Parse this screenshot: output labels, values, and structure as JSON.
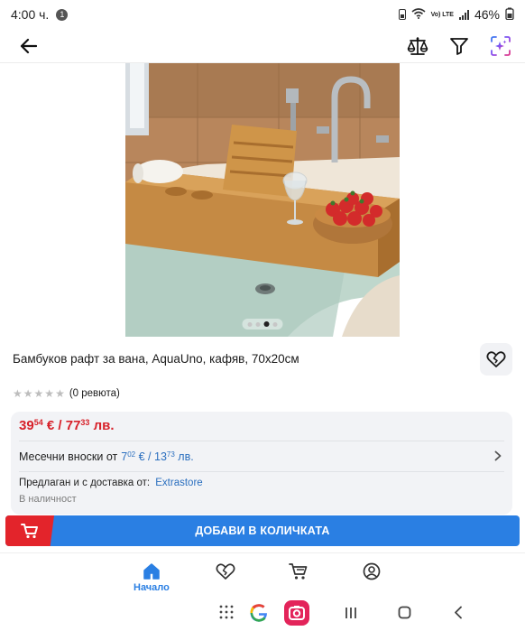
{
  "status_bar": {
    "time": "4:00 ч.",
    "notification_count": "1",
    "network_label": "Vo) LTE",
    "battery": "46%"
  },
  "header": {
    "back_icon": "arrow-left-icon",
    "compare_icon": "compare-scale-icon",
    "filter_icon": "filter-icon",
    "ai_icon": "ai-sparkle-icon"
  },
  "product": {
    "title": "Бамбуков рафт за вана, AquaUno, кафяв, 70x20см",
    "rating_text": "(0 ревюта)",
    "rating_stars": 0,
    "image_pages": 4,
    "image_active_index": 2
  },
  "price": {
    "eur_whole": "39",
    "eur_cents": "54",
    "eur_currency": "€",
    "separator": "/",
    "bgn_whole": "77",
    "bgn_cents": "33",
    "bgn_currency": "лв."
  },
  "installments": {
    "label": "Месечни вноски от",
    "eur_whole": "7",
    "eur_cents": "02",
    "eur_currency": "€",
    "separator": "/",
    "bgn_whole": "13",
    "bgn_cents": "73",
    "bgn_currency": "лв."
  },
  "seller": {
    "label": "Предлаган и с доставка от:",
    "name": "Extrastore",
    "stock": "В наличност"
  },
  "cart_button": {
    "label": "ДОБАВИ В КОЛИЧКАТА"
  },
  "bottom_nav": {
    "home_label": "Начало"
  },
  "colors": {
    "accent_blue": "#2a7fe3",
    "accent_red": "#e3242b",
    "price_red": "#d7212a"
  }
}
